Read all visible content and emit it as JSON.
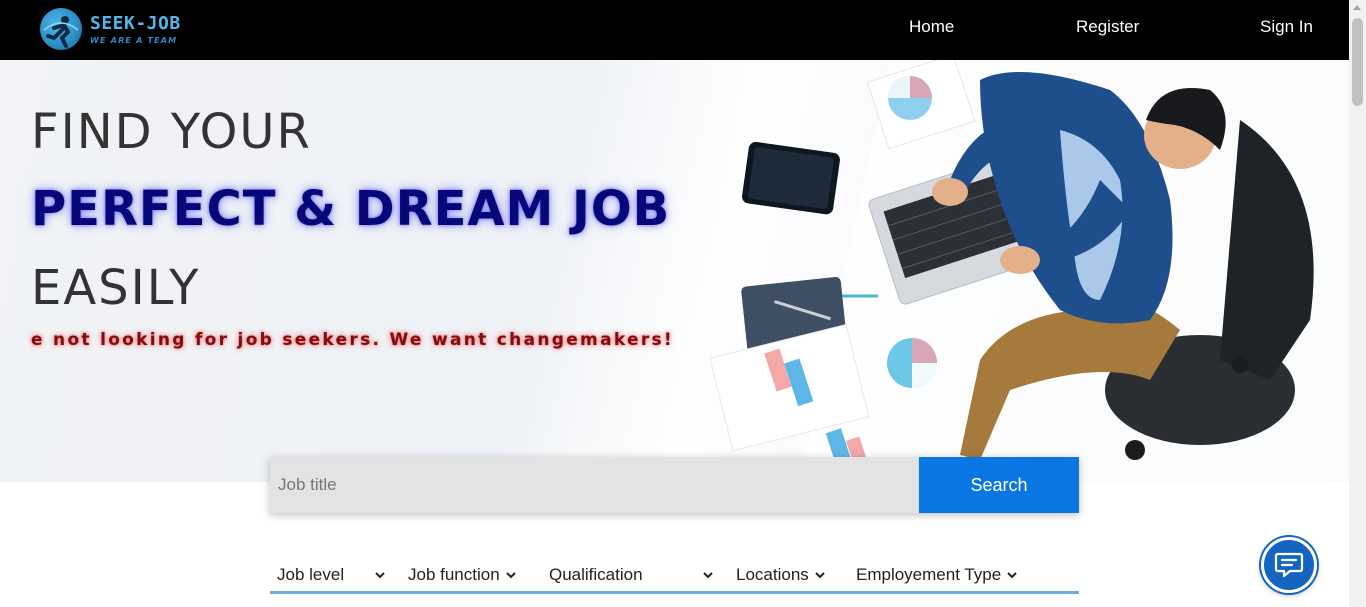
{
  "header": {
    "brand_name": "SEEK-JOB",
    "brand_tagline": "WE ARE A TEAM",
    "nav": {
      "home": "Home",
      "register": "Register",
      "signin": "Sign In"
    }
  },
  "hero": {
    "line1": "FIND YOUR",
    "line2": "PERFECT & DREAM JOB",
    "line3": "EASILY",
    "tagline": "e not looking for job seekers. We want changemakers!"
  },
  "search": {
    "placeholder": "Job title",
    "value": "",
    "button_label": "Search"
  },
  "filters": [
    {
      "label": "Job level"
    },
    {
      "label": "Job function"
    },
    {
      "label": "Qualification"
    },
    {
      "label": "Locations"
    },
    {
      "label": "Employement Type"
    }
  ],
  "icons": {
    "logo": "seek-job-logo",
    "chevron": "chevron-down-icon",
    "chat": "chat-icon"
  },
  "colors": {
    "header_bg": "#000000",
    "brand_accent": "#4fb8e8",
    "headline_blue": "#06087a",
    "tagline_red": "#7a0f14",
    "search_button": "#0a76e3",
    "filter_underline": "#6aaee8",
    "chat_fab": "#1565c0"
  }
}
